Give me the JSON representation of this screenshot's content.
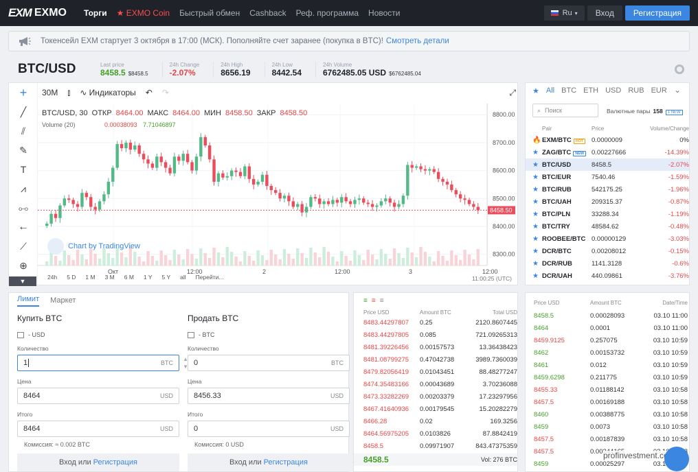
{
  "topbar": {
    "logo_mark": "EXM",
    "logo_text": "EXMO",
    "nav": [
      {
        "label": "Торги"
      },
      {
        "label": "★ EXMO Coin"
      },
      {
        "label": "Быстрый обмен"
      },
      {
        "label": "Cashback"
      },
      {
        "label": "Реф. программа"
      },
      {
        "label": "Новости"
      }
    ],
    "lang": "Ru",
    "login": "Вход",
    "register": "Регистрация"
  },
  "notice": {
    "text": "Токенсейл EXM стартует 3 октября в 17:00 (МСК). Пополняйте счет заранее (покупка в BTC)!",
    "link": "Смотреть детали"
  },
  "pair": {
    "name": "BTC/USD",
    "stats": [
      {
        "label": "Last price",
        "value": "8458.5",
        "sub": "$8458.5",
        "tone": "green"
      },
      {
        "label": "24h Change",
        "value": "-2.07%",
        "sub": "",
        "tone": "red"
      },
      {
        "label": "24h High",
        "value": "8656.19",
        "sub": "",
        "tone": ""
      },
      {
        "label": "24h Low",
        "value": "8442.54",
        "sub": "",
        "tone": ""
      },
      {
        "label": "24h Volume",
        "value": "6762485.05 USD",
        "sub": "$6762485.04",
        "tone": ""
      }
    ]
  },
  "chart_toolbar": {
    "interval": "30М",
    "indicators": "Индикаторы"
  },
  "chart_data": {
    "type": "candlestick",
    "legend": {
      "symbol": "BTC/USD, 30",
      "open_label": "ОТКР",
      "open": "8464.00",
      "high_label": "МАКС",
      "high": "8464.00",
      "low_label": "МИН",
      "low": "8458.50",
      "close_label": "ЗАКР",
      "close": "8458.50"
    },
    "volume_legend": {
      "label": "Volume (20)",
      "v1": "0.00038093",
      "v2": "7.71046897"
    },
    "y_ticks": [
      "8800.00",
      "8700.00",
      "8600.00",
      "8500.00",
      "8400.00",
      "8300.00"
    ],
    "ylim": [
      8260,
      8830
    ],
    "x_ticks": [
      "Окт",
      "12:00",
      "2",
      "12:00",
      "3",
      "12:00"
    ],
    "last_price_label": "8458.50",
    "close_series": [
      8410,
      8445,
      8430,
      8475,
      8500,
      8495,
      8480,
      8470,
      8520,
      8505,
      8470,
      8460,
      8490,
      8515,
      8560,
      8610,
      8695,
      8680,
      8700,
      8675,
      8690,
      8660,
      8640,
      8625,
      8610,
      8650,
      8630,
      8610,
      8590,
      8650,
      8635,
      8660,
      8630,
      8600,
      8650,
      8720,
      8690,
      8640,
      8560,
      8590,
      8575,
      8580,
      8600,
      8595,
      8580,
      8615,
      8570,
      8550,
      8560,
      8585,
      8545,
      8530,
      8520,
      8500,
      8510,
      8490,
      8470,
      8480,
      8450,
      8470,
      8505,
      8500,
      8480,
      8490,
      8480,
      8495,
      8485,
      8505,
      8490,
      8480,
      8495,
      8500,
      8485,
      8480,
      8470,
      8475,
      8490,
      8500,
      8485,
      8470,
      8480,
      8510,
      8620,
      8610,
      8615,
      8605,
      8600,
      8605,
      8595,
      8570,
      8560,
      8550,
      8530,
      8515,
      8500,
      8495,
      8480,
      8470,
      8458
    ]
  },
  "chart_footer": {
    "ranges": [
      "24h",
      "5 D",
      "1 M",
      "3 M",
      "6 M",
      "1 Y",
      "5 Y",
      "all",
      "Перейти..."
    ],
    "time": "11:00:25 (UTC)"
  },
  "tradingview": "Chart by TradingView",
  "order_form": {
    "tabs": [
      "Лимит",
      "Маркет"
    ],
    "buy": {
      "title": "Купить BTC",
      "balance": "- USD",
      "qty_label": "Количество",
      "qty": "1",
      "qty_unit": "BTC",
      "price_label": "Цена",
      "price": "8464",
      "price_unit": "USD",
      "total_label": "Итого",
      "total": "8464",
      "total_unit": "USD",
      "fee": "Комиссия: ≈ 0.002 BTC"
    },
    "sell": {
      "title": "Продать BTC",
      "balance": "- BTC",
      "qty_label": "Количество",
      "qty": "0",
      "qty_unit": "BTC",
      "price_label": "Цена",
      "price": "8456.33",
      "price_unit": "USD",
      "total_label": "Итого",
      "total": "0",
      "total_unit": "USD",
      "fee": "Комиссия: 0 USD"
    },
    "auth": {
      "login": "Вход",
      "or": "или",
      "register": "Регистрация"
    }
  },
  "order_book": {
    "headers": [
      "Price USD",
      "Amount BTC",
      "Total USD"
    ],
    "rows": [
      [
        "8483.44297807",
        "0.25",
        "2120.8607445"
      ],
      [
        "8483.44297805",
        "0.085",
        "721.09265313"
      ],
      [
        "8481.39226456",
        "0.00157573",
        "13.36438423"
      ],
      [
        "8481.08799275",
        "0.47042738",
        "3989.7360039"
      ],
      [
        "8479.82056419",
        "0.01043451",
        "88.48277247"
      ],
      [
        "8474.35483166",
        "0.00043689",
        "3.70236088"
      ],
      [
        "8473.33282269",
        "0.00203379",
        "17.23297956"
      ],
      [
        "8467.41640936",
        "0.00179545",
        "15.20282279"
      ],
      [
        "8466.28",
        "0.02",
        "169.3256"
      ],
      [
        "8464.56975205",
        "0.0103826",
        "87.8842419"
      ],
      [
        "8458.5",
        "0.09971907",
        "843.47375359"
      ]
    ],
    "last": "8458.5",
    "vol": "Vol: 276 BTC"
  },
  "trade_history": {
    "headers": [
      "Price USD",
      "Amount BTC",
      "Date/Time"
    ],
    "rows": [
      [
        "8458.5",
        "0.00028093",
        "03.10 11:00",
        "green"
      ],
      [
        "8464",
        "0.0001",
        "03.10 11:00",
        "green"
      ],
      [
        "8459.9125",
        "0.257075",
        "03.10 10:59",
        "red"
      ],
      [
        "8462",
        "0.00153732",
        "03.10 10:59",
        "green"
      ],
      [
        "8461",
        "0.012",
        "03.10 10:59",
        "green"
      ],
      [
        "8459.6298",
        "0.211775",
        "03.10 10:59",
        "green"
      ],
      [
        "8455.33",
        "0.01188142",
        "03.10 10:58",
        "red"
      ],
      [
        "8457.5",
        "0.00169188",
        "03.10 10:58",
        "red"
      ],
      [
        "8460",
        "0.00388775",
        "03.10 10:58",
        "green"
      ],
      [
        "8459",
        "0.0073",
        "03.10 10:58",
        "green"
      ],
      [
        "8457.5",
        "0.00187839",
        "03.10 10:58",
        "red"
      ],
      [
        "8457.5",
        "0.00344165",
        "03.10 10:58",
        "red"
      ],
      [
        "8459",
        "0.00025297",
        "03.10 10:58",
        "green"
      ]
    ]
  },
  "pairs": {
    "tabs": [
      "All",
      "BTC",
      "ETH",
      "USD",
      "RUB",
      "EUR"
    ],
    "search": "Поиск",
    "count_label": "Валютные пары",
    "count": "158",
    "new_chip": "1 NEW",
    "headers": [
      "Pair",
      "Price",
      "Volume/Change"
    ],
    "rows": [
      [
        "EXM/BTC",
        "0.0000009",
        "0%",
        "hot"
      ],
      [
        "ZAG/BTC",
        "0.00227666",
        "-14.39%",
        "new"
      ],
      [
        "BTC/USD",
        "8458.5",
        "-2.07%",
        "sel"
      ],
      [
        "BTC/EUR",
        "7540.46",
        "-1.59%",
        ""
      ],
      [
        "BTC/RUB",
        "542175.25",
        "-1.96%",
        ""
      ],
      [
        "BTC/UAH",
        "209315.37",
        "-0.87%",
        ""
      ],
      [
        "BTC/PLN",
        "33288.34",
        "-1.19%",
        ""
      ],
      [
        "BTC/TRY",
        "48584.62",
        "-0.48%",
        ""
      ],
      [
        "ROOBEE/BTC",
        "0.00000129",
        "-3.03%",
        ""
      ],
      [
        "DCR/BTC",
        "0.00208012",
        "-0.15%",
        ""
      ],
      [
        "DCR/RUB",
        "1141.3128",
        "-0.6%",
        ""
      ],
      [
        "DCR/UAH",
        "440.09861",
        "-3.76%",
        ""
      ]
    ]
  },
  "watermark": "profinvestment.com"
}
